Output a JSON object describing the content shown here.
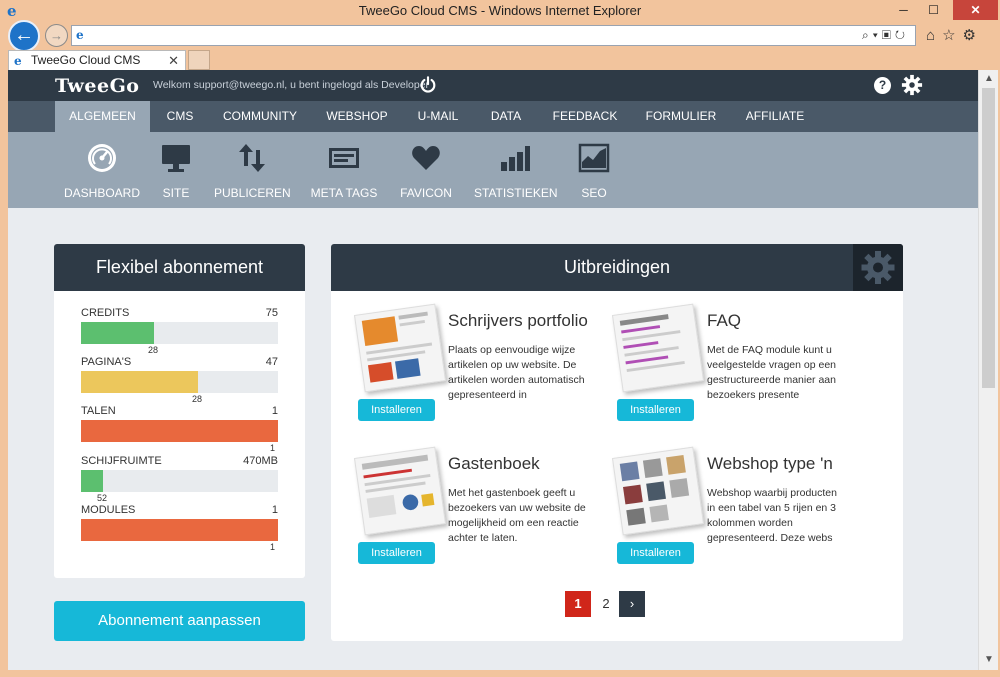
{
  "window": {
    "title": "TweeGo Cloud CMS - Windows Internet Explorer",
    "tab_title": "TweeGo Cloud CMS",
    "minimize": "─",
    "maximize": "☐",
    "close": "✕",
    "back": "←",
    "forward": "→",
    "tab_close": "✕"
  },
  "header": {
    "logo": "TweeGo",
    "welcome": "Welkom support@tweego.nl, u bent ingelogd als Developer",
    "help": "?"
  },
  "menu": [
    {
      "label": "ALGEMEEN",
      "active": true
    },
    {
      "label": "CMS"
    },
    {
      "label": "COMMUNITY"
    },
    {
      "label": "WEBSHOP"
    },
    {
      "label": "U-MAIL"
    },
    {
      "label": "DATA"
    },
    {
      "label": "FEEDBACK"
    },
    {
      "label": "FORMULIER"
    },
    {
      "label": "AFFILIATE"
    }
  ],
  "submenu": [
    {
      "label": "DASHBOARD",
      "icon": "dashboard-icon",
      "active": true
    },
    {
      "label": "SITE",
      "icon": "monitor-icon"
    },
    {
      "label": "PUBLICEREN",
      "icon": "publish-arrows-icon"
    },
    {
      "label": "META TAGS",
      "icon": "meta-tags-icon"
    },
    {
      "label": "FAVICON",
      "icon": "heart-icon"
    },
    {
      "label": "STATISTIEKEN",
      "icon": "bar-chart-icon"
    },
    {
      "label": "SEO",
      "icon": "seo-chart-icon"
    }
  ],
  "subscription": {
    "title": "Flexibel abonnement",
    "items": [
      {
        "label": "CREDITS",
        "total": "75",
        "used": "28",
        "fraction": 0.373,
        "color": "#5cbf6f"
      },
      {
        "label": "PAGINA'S",
        "total": "47",
        "used": "28",
        "fraction": 0.596,
        "color": "#ecc75c"
      },
      {
        "label": "TALEN",
        "total": "1",
        "used": "1",
        "fraction": 1.0,
        "color": "#e9683f"
      },
      {
        "label": "SCHIJFRUIMTE",
        "total": "470MB",
        "used": "52",
        "fraction": 0.11,
        "color": "#5cbf6f"
      },
      {
        "label": "MODULES",
        "total": "1",
        "used": "1",
        "fraction": 1.0,
        "color": "#e9683f"
      }
    ],
    "button": "Abonnement aanpassen"
  },
  "extensions": {
    "title": "Uitbreidingen",
    "install_label": "Installeren",
    "items": [
      {
        "title": "Schrijvers portfolio",
        "desc": "Plaats op eenvoudige wijze artikelen op uw website. De artikelen worden automatisch gepresenteerd in"
      },
      {
        "title": "FAQ",
        "desc": "Met de FAQ module kunt u veelgestelde vragen op een gestructureerde manier aan bezoekers presente"
      },
      {
        "title": "Gastenboek",
        "desc": "Met het gastenboek geeft u bezoekers van uw website de mogelijkheid om een reactie achter te laten."
      },
      {
        "title": "Webshop type 'n",
        "desc": "Webshop waarbij producten in een tabel van 5 rijen en 3 kolommen worden gepresenteerd. Deze webs"
      }
    ],
    "pager": {
      "current": "1",
      "next_page": "2",
      "next": "›"
    }
  }
}
